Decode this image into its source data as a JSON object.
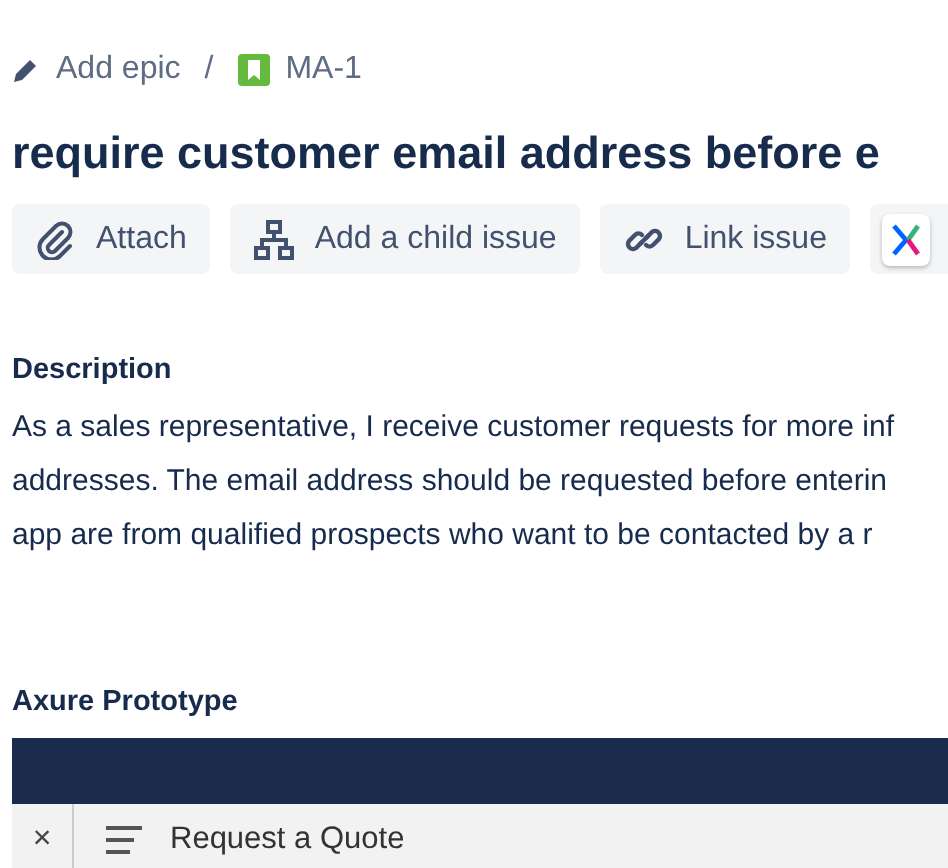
{
  "breadcrumb": {
    "epic": "Add epic",
    "separator": "/",
    "issue_key": "MA-1"
  },
  "title": "require customer email address before e",
  "actions": [
    {
      "kind": "attach",
      "label": "Attach"
    },
    {
      "kind": "child",
      "label": "Add a child issue"
    },
    {
      "kind": "link",
      "label": "Link issue"
    },
    {
      "kind": "app"
    }
  ],
  "description": {
    "heading": "Description",
    "lines": [
      "As a sales representative, I receive customer requests for more inf",
      "addresses. The email address should be requested before enterin",
      "app are from qualified prospects who want to be contacted by a r"
    ]
  },
  "prototype": {
    "heading": "Axure Prototype",
    "close": "×",
    "page_title": "Request a Quote"
  }
}
